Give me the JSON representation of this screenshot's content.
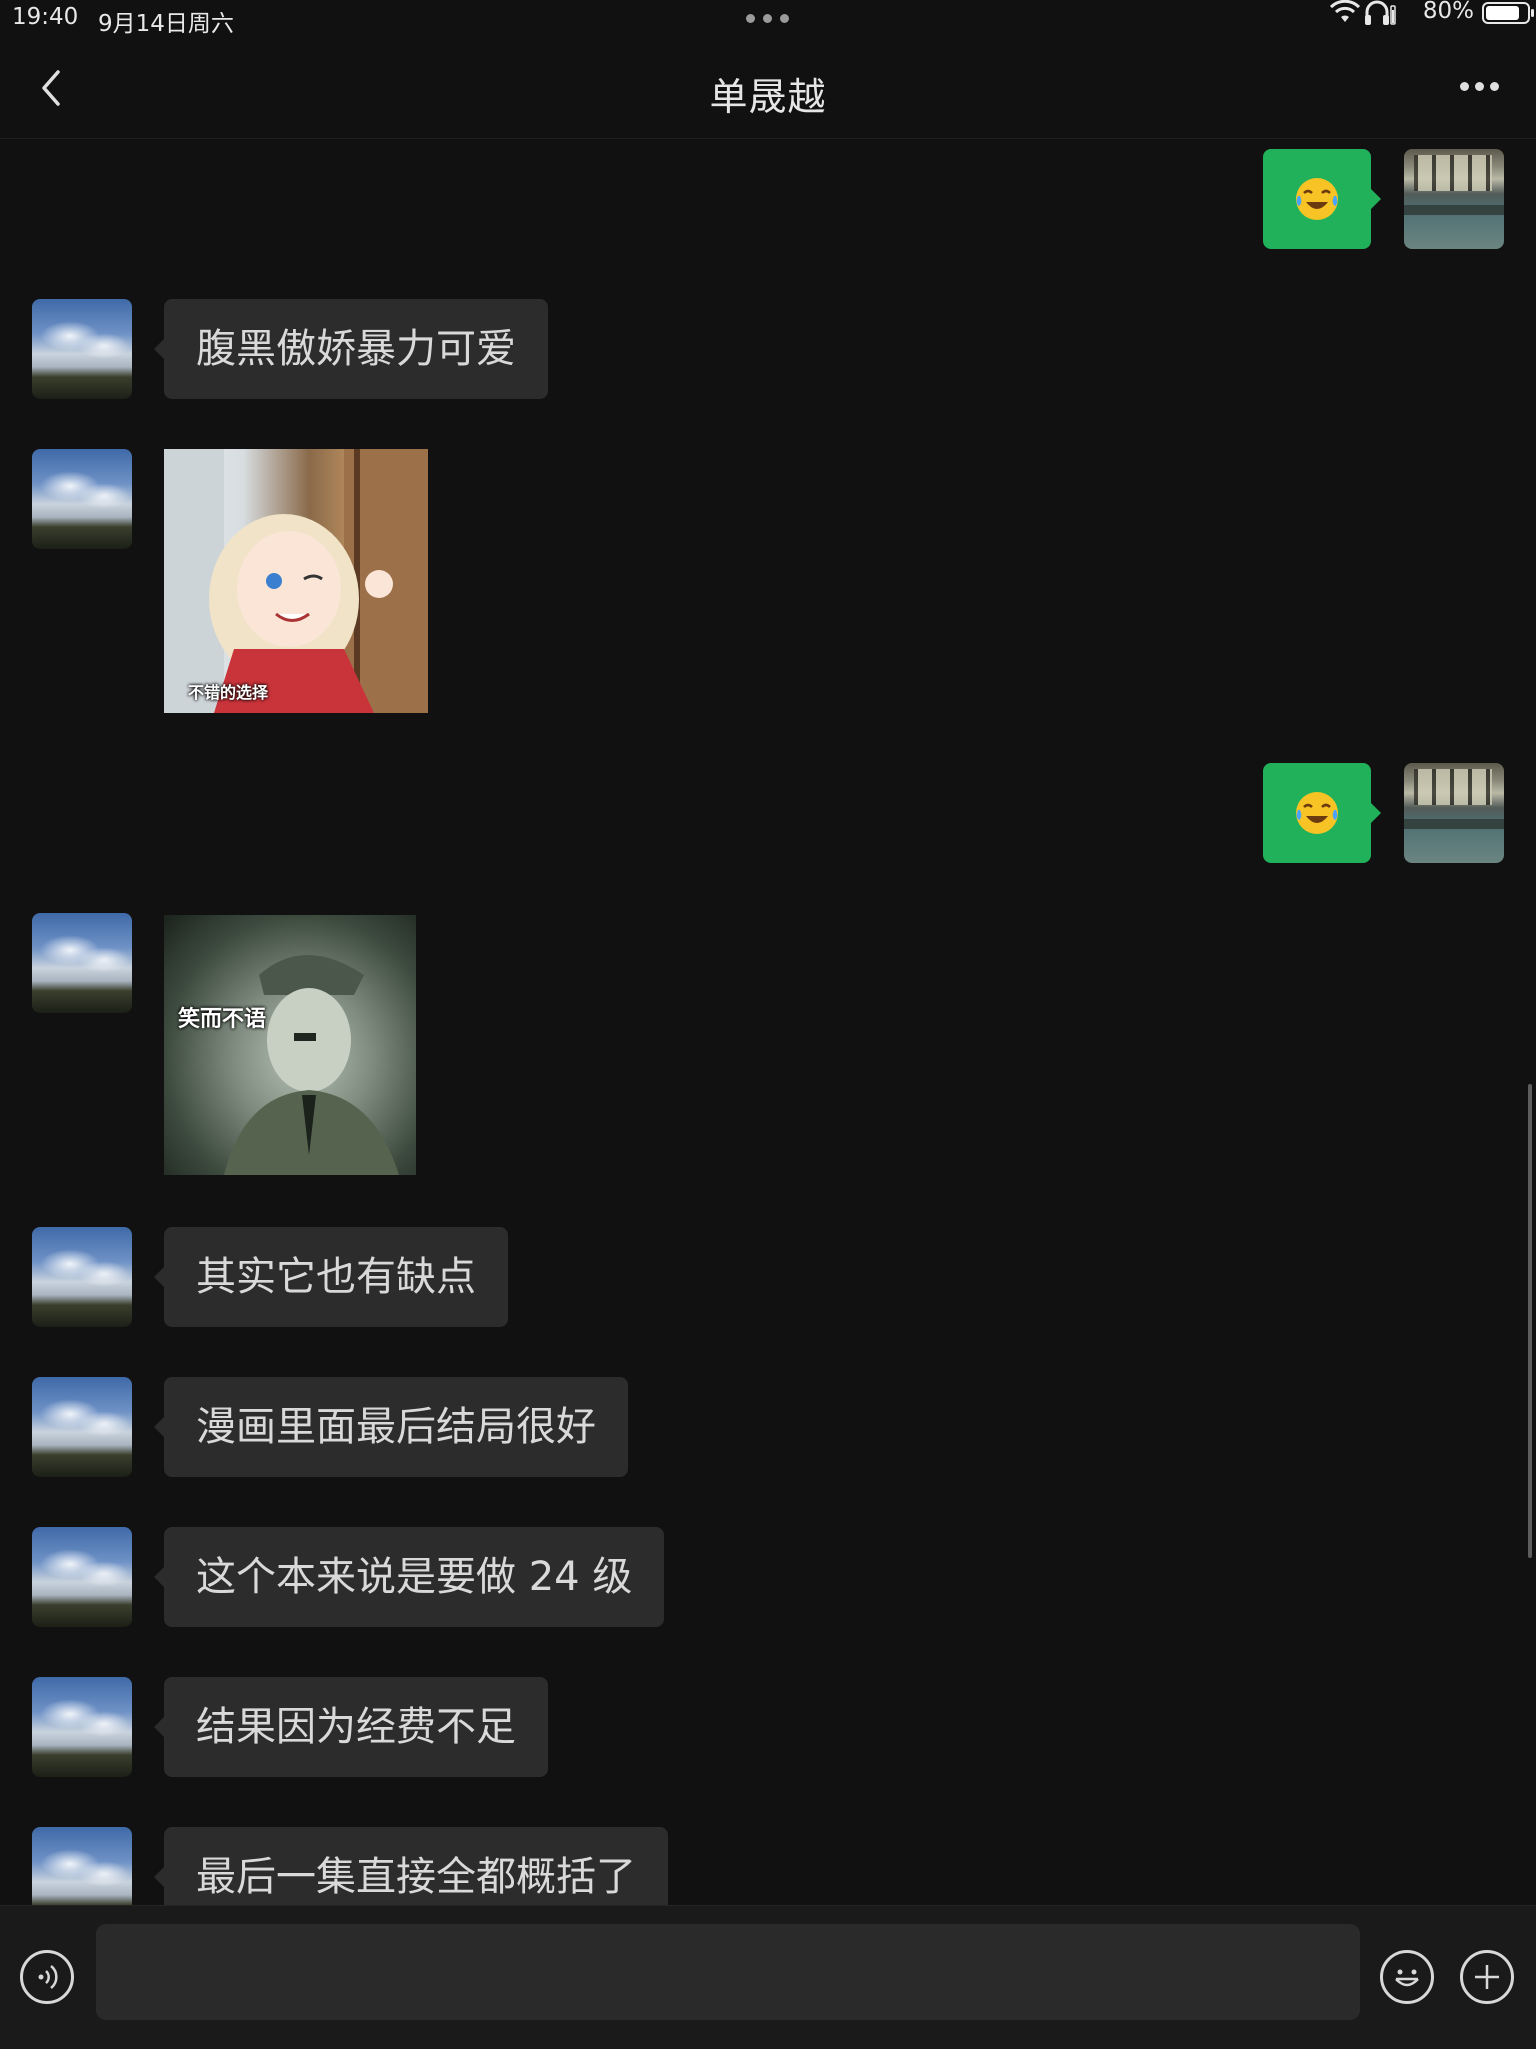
{
  "status_bar": {
    "time": "19:40",
    "date": "9月14日周六",
    "battery": "80%"
  },
  "nav": {
    "title": "单晟越",
    "back_icon": "chevron-left-icon",
    "more_icon": "more-dots-icon"
  },
  "messages": [
    {
      "side": "self",
      "type": "emoji",
      "emoji": "😭"
    },
    {
      "side": "contact",
      "type": "text",
      "text": "腹黑傲娇暴力可爱"
    },
    {
      "side": "contact",
      "type": "sticker",
      "caption": "不错的选择"
    },
    {
      "side": "self",
      "type": "emoji",
      "emoji": "😭"
    },
    {
      "side": "contact",
      "type": "sticker",
      "caption": "笑而不语"
    },
    {
      "side": "contact",
      "type": "text",
      "text": "其实它也有缺点"
    },
    {
      "side": "contact",
      "type": "text",
      "text": "漫画里面最后结局很好"
    },
    {
      "side": "contact",
      "type": "text",
      "text": "这个本来说是要做 24 级"
    },
    {
      "side": "contact",
      "type": "text",
      "text": "结果因为经费不足"
    },
    {
      "side": "contact",
      "type": "text",
      "text": "最后一集直接全都概括了"
    }
  ],
  "input_bar": {
    "value": "",
    "voice_icon": "voice-icon",
    "emoji_icon": "smiley-icon",
    "plus_icon": "plus-icon"
  },
  "colors": {
    "background": "#111111",
    "contact_bubble": "#2c2c2c",
    "self_bubble": "#21b15a",
    "text": "#d9d9d9"
  }
}
